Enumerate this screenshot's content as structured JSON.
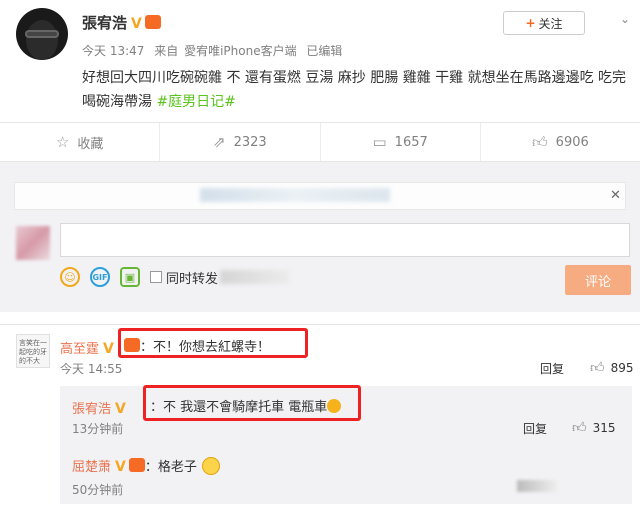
{
  "post": {
    "username": "張宥浩",
    "verified_badge": "V",
    "follow_label": "关注",
    "meta_time": "今天 13:47",
    "meta_from": "来自",
    "meta_client": "愛宥唯iPhone客户端",
    "meta_edited": "已编辑",
    "text": "好想回大四川吃碗碗雜 不 還有蛋燃 豆湯 麻抄 肥腸 雞雜 干雞 就想坐在馬路邊邊吃 吃完喝碗海帶湯 ",
    "hashtag": "#庭男日记#"
  },
  "actions": {
    "favorite_label": "收藏",
    "repost_count": "2323",
    "comment_count": "1657",
    "like_count": "6906"
  },
  "composer": {
    "toolbar_checkbox_label": "同时转发",
    "submit_label": "评论"
  },
  "comments": [
    {
      "name": "高至霆",
      "avatar_text": "言笑在一起吃的牙的不大",
      "text": "：不！你想去紅螺寺！",
      "time": "今天 14:55",
      "reply_label": "回复",
      "likes": "895"
    }
  ],
  "subcomments": [
    {
      "name": "張宥浩",
      "text": "：不 我還不會騎摩托車 電瓶車",
      "time": "13分钟前",
      "reply_label": "回复",
      "likes": "315"
    },
    {
      "name": "屈楚萧",
      "text": "：格老子",
      "time": "50分钟前"
    }
  ],
  "colors": {
    "accent_orange": "#eb7350",
    "hashtag_green": "#5ac41d",
    "highlight_red": "#e22222",
    "submit_bg": "#f7ab80"
  }
}
